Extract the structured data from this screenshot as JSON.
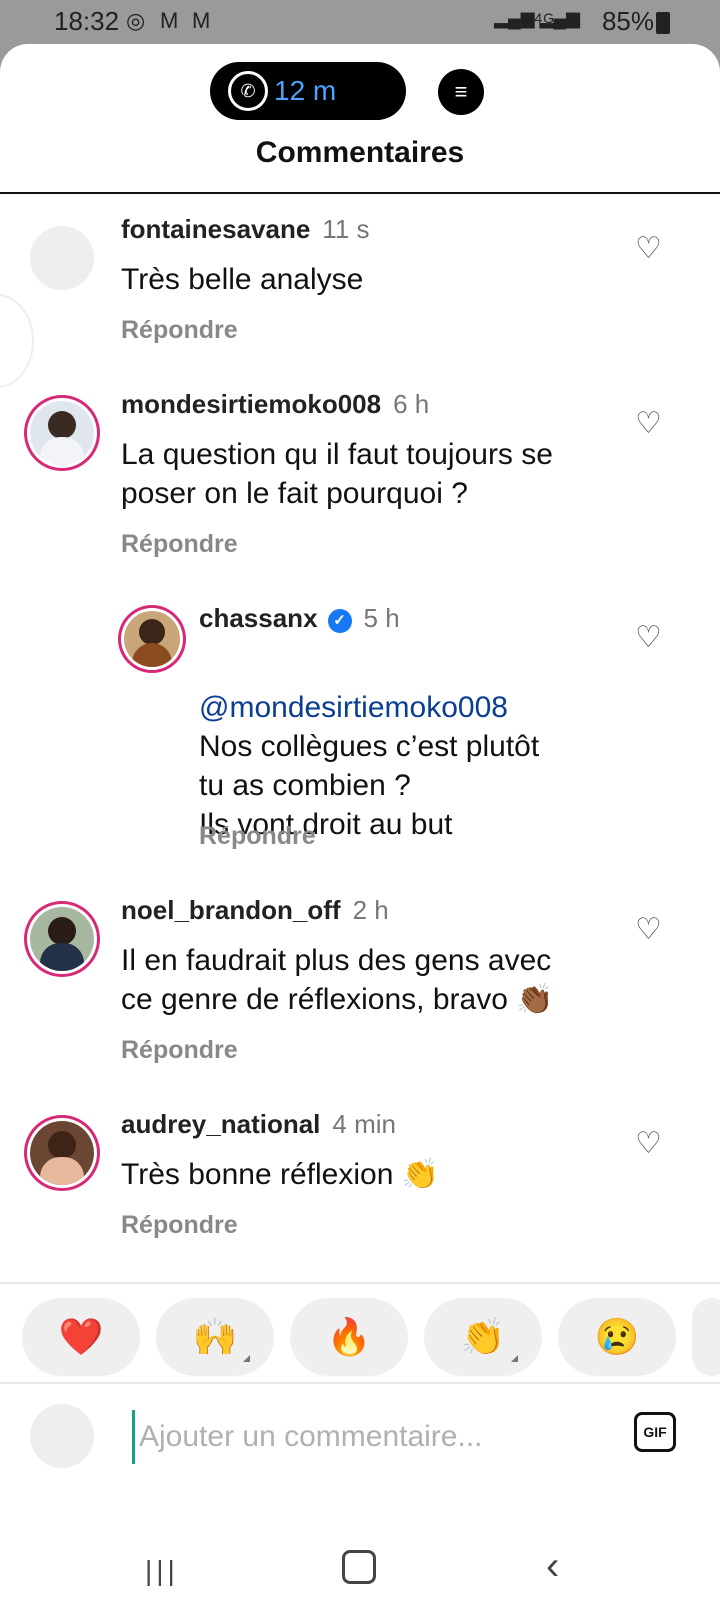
{
  "status_bar": {
    "time": "18:32",
    "app_icons": [
      "whatsapp-icon",
      "gmail-icon",
      "gmail-icon"
    ],
    "network": "4G",
    "battery": "85%"
  },
  "call_pill": {
    "duration": "12 m"
  },
  "header": {
    "title": "Commentaires"
  },
  "comments": [
    {
      "user": "fontainesavane",
      "time": "11 s",
      "text": "Très belle analyse",
      "reply": "Répondre"
    },
    {
      "user": "mondesirtiemoko008",
      "time": "6 h",
      "text": "La question qu il faut toujours se\nposer on le fait pourquoi ?",
      "reply": "Répondre"
    },
    {
      "user": "chassanx",
      "time": "5 h",
      "mention": "@mondesirtiemoko008",
      "text": "Nos collègues c’est plutôt\ntu as combien ?\nIls vont droit au but",
      "reply": "Répondre",
      "verified": true
    },
    {
      "user": "noel_brandon_off",
      "time": "2 h",
      "text": "Il en faudrait plus des gens avec\nce genre de réflexions, bravo 👏🏾",
      "reply": "Répondre"
    },
    {
      "user": "audrey_national",
      "time": "4 min",
      "text": "Très bonne réflexion 👏",
      "reply": "Répondre"
    }
  ],
  "reactions": [
    "❤️",
    "🙌",
    "🔥",
    "👏",
    "😢"
  ],
  "input": {
    "placeholder": "Ajouter un commentaire...",
    "gif_label": "GIF"
  },
  "colors": {
    "mention": "#0b3d91",
    "verified": "#1877f2",
    "story_ring": "#d62976"
  }
}
